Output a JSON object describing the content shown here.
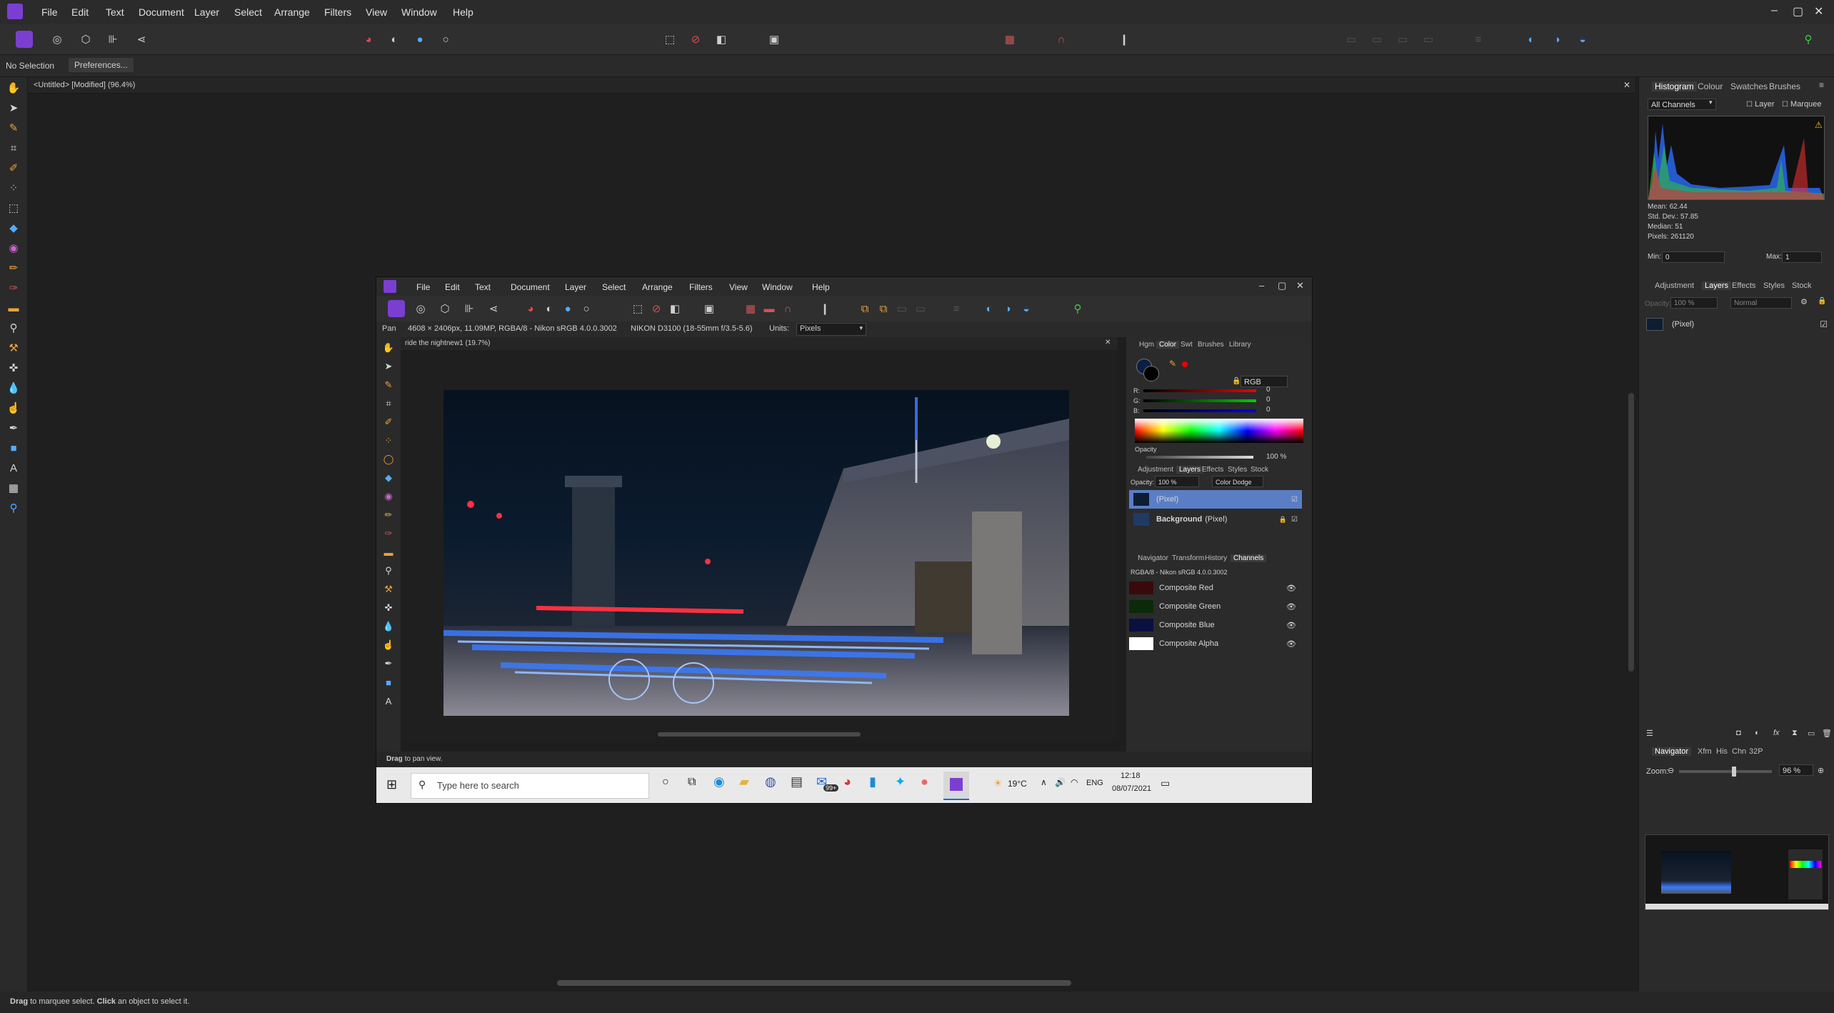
{
  "app": {
    "menu": [
      "File",
      "Edit",
      "Text",
      "Document",
      "Layer",
      "Select",
      "Arrange",
      "Filters",
      "View",
      "Window",
      "Help"
    ],
    "context": {
      "selection": "No Selection",
      "preferences": "Preferences..."
    },
    "doc_tab": "<Untitled> [Modified] (96.4%)",
    "status": {
      "bold1": "Drag",
      "text1": " to marquee select. ",
      "bold2": "Click",
      "text2": " an object to select it."
    },
    "colors": {
      "accent": "#7a3fd1",
      "panel": "#2b2b2b",
      "bg": "#1f1f1f"
    }
  },
  "right_panel": {
    "top_tabs": [
      "Histogram",
      "Colour",
      "Swatches",
      "Brushes"
    ],
    "histogram": {
      "channel": "All Channels",
      "layer_label": "Layer",
      "marquee_label": "Marquee",
      "mean": "Mean: 62.44",
      "std": "Std. Dev.: 57.85",
      "median": "Median: 51",
      "pixels": "Pixels: 261120",
      "min_label": "Min:",
      "min_val": "0",
      "max_label": "Max:",
      "max_val": "1"
    },
    "mid_tabs": [
      "Adjustment",
      "Layers",
      "Effects",
      "Styles",
      "Stock"
    ],
    "layers": {
      "opacity_label": "Opacity:",
      "opacity": "100 %",
      "blend": "Normal",
      "row": "(Pixel)"
    },
    "nav_tabs": [
      "Navigator",
      "Xfm",
      "His",
      "Chn",
      "32P"
    ],
    "zoom_label": "Zoom:",
    "zoom": "96 %"
  },
  "inner": {
    "menu": [
      "File",
      "Edit",
      "Text",
      "Document",
      "Layer",
      "Select",
      "Arrange",
      "Filters",
      "View",
      "Window",
      "Help"
    ],
    "context": {
      "tool": "Pan",
      "info": "4608 × 2406px, 11.09MP, RGBA/8 - Nikon sRGB 4.0.0.3002",
      "camera": "NIKON D3100 (18-55mm f/3.5-5.6)",
      "units_label": "Units:",
      "units": "Pixels"
    },
    "doc_tab": "ride the nightnew1 (19.7%)",
    "panel_tabs": [
      "Hgm",
      "Color",
      "Swt",
      "Brushes",
      "Library"
    ],
    "color": {
      "mode": "RGB",
      "r_label": "R:",
      "g_label": "G:",
      "b_label": "B:",
      "r": "0",
      "g": "0",
      "b": "0",
      "opacity_label": "Opacity",
      "opacity": "100 %"
    },
    "layer_tabs": [
      "Adjustment",
      "Layers",
      "Effects",
      "Styles",
      "Stock"
    ],
    "layers": {
      "opacity_label": "Opacity:",
      "opacity": "100 %",
      "blend": "Color Dodge",
      "rows": [
        {
          "name": "(Pixel)"
        },
        {
          "name": "Background",
          "kind": "(Pixel)"
        }
      ]
    },
    "chan_tabs": [
      "Navigator",
      "Transform",
      "History",
      "Channels"
    ],
    "channels": {
      "profile": "RGBA/8 - Nikon sRGB 4.0.0.3002",
      "rows": [
        "Composite Red",
        "Composite Green",
        "Composite Blue",
        "Composite Alpha"
      ]
    },
    "status": {
      "bold": "Drag",
      "text": " to pan view."
    },
    "taskbar": {
      "search": "Type here to search",
      "temp": "19°C",
      "lang": "ENG",
      "time": "12:18",
      "date": "08/07/2021",
      "badge": "99+"
    }
  }
}
